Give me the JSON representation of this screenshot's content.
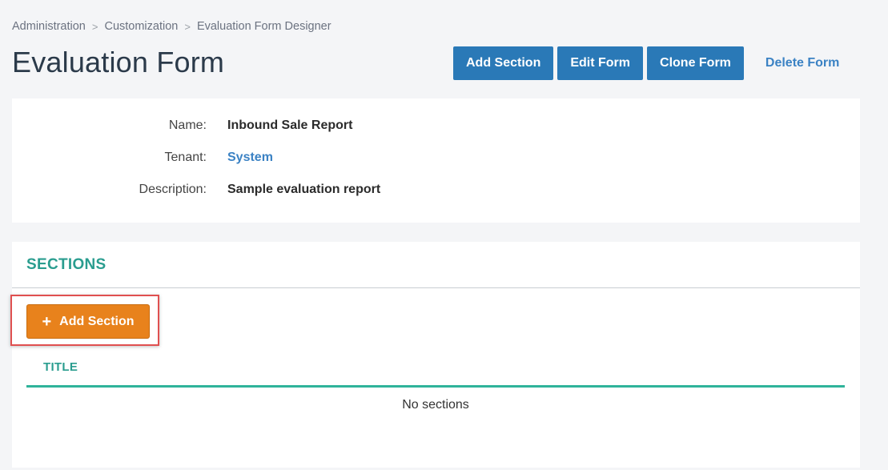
{
  "breadcrumb": {
    "items": [
      "Administration",
      "Customization",
      "Evaluation Form Designer"
    ],
    "separator": ">"
  },
  "page": {
    "title": "Evaluation Form"
  },
  "actions": {
    "add_section": "Add Section",
    "edit_form": "Edit Form",
    "clone_form": "Clone Form",
    "delete_form": "Delete Form"
  },
  "details": {
    "name_label": "Name:",
    "name_value": "Inbound Sale Report",
    "tenant_label": "Tenant:",
    "tenant_value": "System",
    "description_label": "Description:",
    "description_value": "Sample evaluation report"
  },
  "sections": {
    "heading": "SECTIONS",
    "add_button": "Add Section",
    "add_icon": "+",
    "columns": [
      "TITLE"
    ],
    "empty_message": "No sections"
  },
  "colors": {
    "primary_blue": "#2a79b7",
    "accent_teal": "#2a9d8f",
    "orange": "#e8821c",
    "highlight_red": "#e05050"
  }
}
